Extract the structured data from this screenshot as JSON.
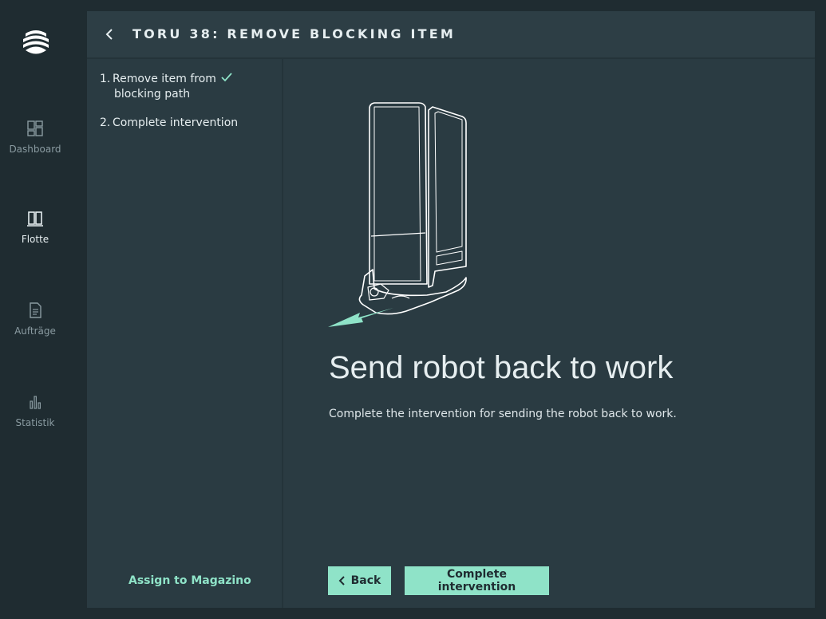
{
  "nav": {
    "items": [
      {
        "label": "Dashboard",
        "icon": "dashboard-icon",
        "active": false
      },
      {
        "label": "Flotte",
        "icon": "fleet-icon",
        "active": true
      },
      {
        "label": "Aufträge",
        "icon": "orders-icon",
        "active": false
      },
      {
        "label": "Statistik",
        "icon": "statistics-icon",
        "active": false
      }
    ]
  },
  "header": {
    "title": "TORU 38: REMOVE BLOCKING ITEM"
  },
  "steps": [
    {
      "number": "1.",
      "line1": "Remove item from",
      "line2": "blocking path",
      "done": true
    },
    {
      "number": "2.",
      "line1": "Complete intervention",
      "line2": "",
      "done": false
    }
  ],
  "assign_link": "Assign to Magazino",
  "main": {
    "headline": "Send robot back to work",
    "description": "Complete the intervention for sending the robot back to work."
  },
  "buttons": {
    "back_label": "Back",
    "complete_label": "Complete intervention"
  },
  "colors": {
    "accent": "#8fe3c8",
    "panel": "#2a3b42",
    "background": "#1f2c31"
  }
}
